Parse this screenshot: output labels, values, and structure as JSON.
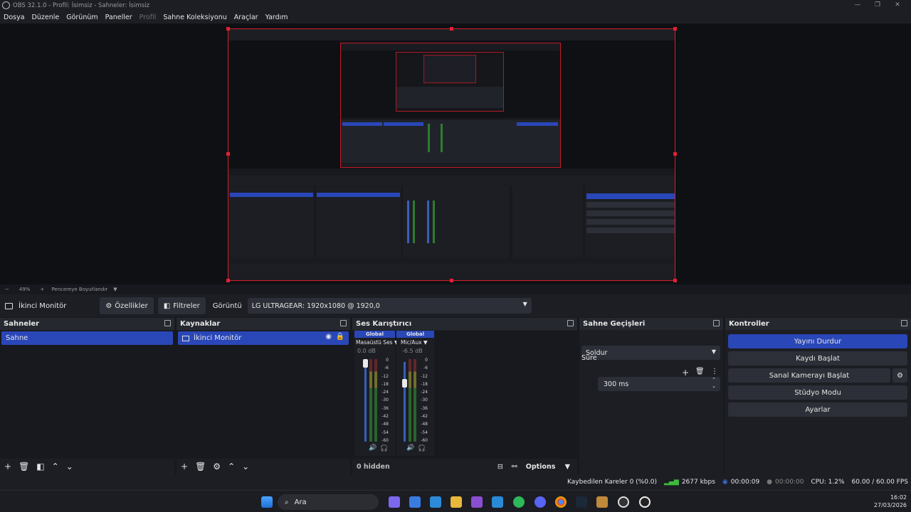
{
  "window": {
    "title": "OBS 32.1.0 - Profil: İsimsiz - Sahneler: İsimsiz"
  },
  "menu": {
    "items": [
      "Dosya",
      "Düzenle",
      "Görünüm",
      "Paneller",
      "Profil",
      "Sahne Koleksiyonu",
      "Araçlar",
      "Yardım"
    ]
  },
  "zoom": {
    "minus": "−",
    "value": "49%",
    "plus": "+",
    "fit": "Pencereye Boyutlandır"
  },
  "toolbar": {
    "source_name": "İkinci Monitör",
    "properties": "Özellikler",
    "filters": "Filtreler",
    "display_label": "Görüntü",
    "display_value": "LG ULTRAGEAR: 1920x1080 @ 1920,0"
  },
  "scenes": {
    "title": "Sahneler",
    "items": [
      "Sahne"
    ]
  },
  "sources": {
    "title": "Kaynaklar",
    "items": [
      "İkinci Monitör"
    ]
  },
  "mixer": {
    "title": "Ses Karıştırıcı",
    "channels": [
      {
        "group": "Global",
        "name": "Masaüstü Ses",
        "db": "0.0 dB",
        "level": 1.0
      },
      {
        "group": "Global",
        "name": "Mic/Aux",
        "db": "-6.5 dB",
        "level": 0.75
      }
    ],
    "ticks": [
      "0",
      "-6",
      "-12",
      "-18",
      "-24",
      "-30",
      "-36",
      "-42",
      "-48",
      "-54",
      "-60"
    ],
    "hidden": "0 hidden",
    "options": "Options"
  },
  "transitions": {
    "title": "Sahne Geçişleri",
    "type": "Soldur",
    "duration_label": "Süre",
    "duration": "300 ms"
  },
  "controls": {
    "title": "Kontroller",
    "stop_stream": "Yayını Durdur",
    "start_record": "Kaydı Başlat",
    "virtual_cam": "Sanal Kamerayı Başlat",
    "studio_mode": "Stüdyo Modu",
    "settings": "Ayarlar"
  },
  "status": {
    "dropped": "Kaybedilen Kareler 0 (%0.0)",
    "bitrate": "2677 kbps",
    "stream_time": "00:00:09",
    "record_time": "00:00:00",
    "cpu": "CPU: 1.2%",
    "fps": "60.00 / 60.00 FPS"
  },
  "taskbar": {
    "search": "Ara",
    "time": "16:02",
    "date": "27/03/2026"
  },
  "colors": {
    "accent": "#2a47b8",
    "selection_border": "#d71d2b"
  }
}
